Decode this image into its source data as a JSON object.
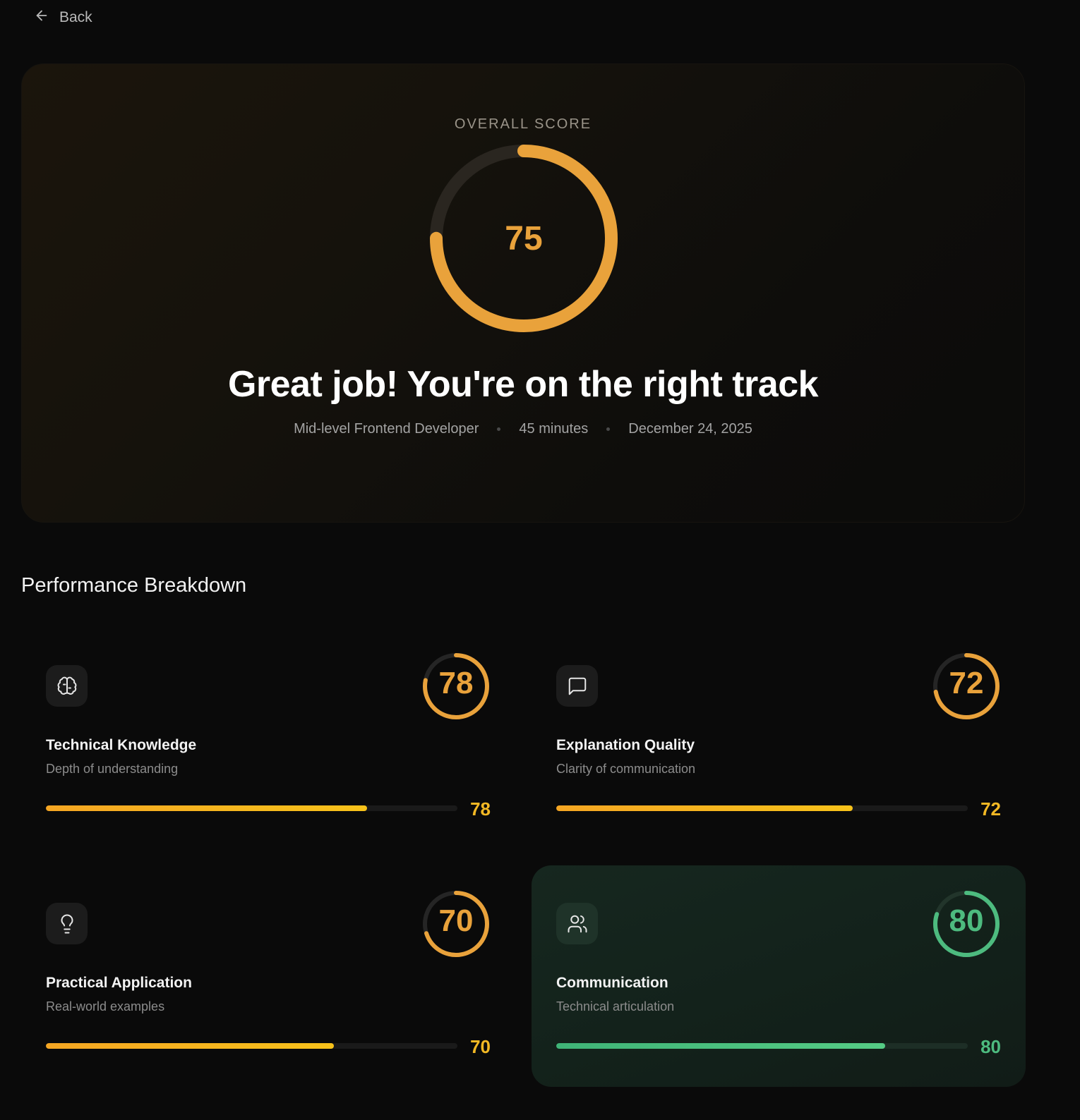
{
  "nav": {
    "back_label": "Back",
    "back_icon": "arrow-left-icon"
  },
  "hero": {
    "overall_label": "OVERALL SCORE",
    "score": 75,
    "score_text": "75",
    "headline": "Great job! You're on the right track",
    "meta": {
      "role": "Mid-level Frontend Developer",
      "duration": "45 minutes",
      "date": "December 24, 2025"
    }
  },
  "breakdown": {
    "title": "Performance Breakdown",
    "cards": [
      {
        "title": "Technical Knowledge",
        "subtitle": "Depth of understanding",
        "score": 78,
        "score_text": "78",
        "icon": "brain-icon",
        "color": "#e9a23b",
        "bar_color_start": "#f5a623",
        "bar_color_end": "#f7c21a",
        "value_color": "#f2b824",
        "highlight": false
      },
      {
        "title": "Explanation Quality",
        "subtitle": "Clarity of communication",
        "score": 72,
        "score_text": "72",
        "icon": "message-square-icon",
        "color": "#e9a23b",
        "bar_color_start": "#f5a623",
        "bar_color_end": "#f7c21a",
        "value_color": "#f2b824",
        "highlight": false
      },
      {
        "title": "Practical Application",
        "subtitle": "Real-world examples",
        "score": 70,
        "score_text": "70",
        "icon": "lightbulb-icon",
        "color": "#e9a23b",
        "bar_color_start": "#f5a623",
        "bar_color_end": "#f7c21a",
        "value_color": "#f2b824",
        "highlight": false
      },
      {
        "title": "Communication",
        "subtitle": "Technical articulation",
        "score": 80,
        "score_text": "80",
        "icon": "users-icon",
        "color": "#4dbb7f",
        "bar_color_start": "#3fb477",
        "bar_color_end": "#55cc85",
        "value_color": "#4dbb7f",
        "highlight": true
      }
    ]
  },
  "colors": {
    "accent": "#e9a23b",
    "success": "#4dbb7f",
    "background": "#0a0a0a"
  }
}
